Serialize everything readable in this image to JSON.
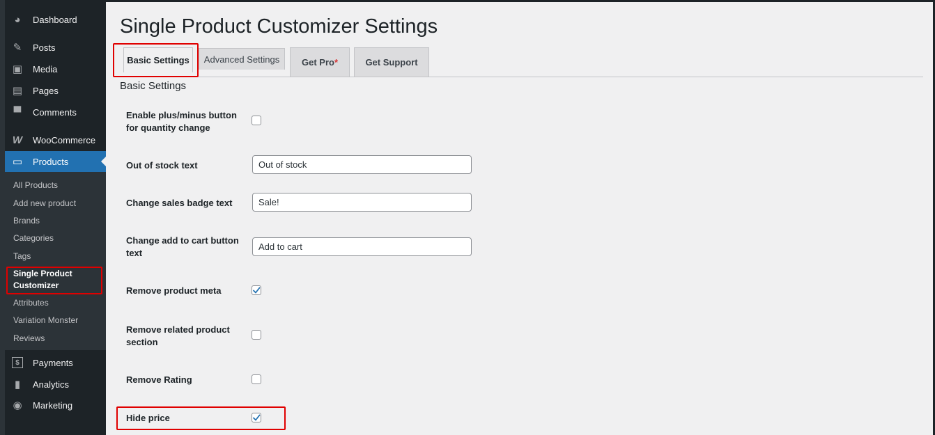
{
  "sidebar": {
    "items": [
      {
        "label": "Dashboard",
        "icon": "dashboard-icon"
      },
      {
        "label": "Posts",
        "icon": "pin-icon"
      },
      {
        "label": "Media",
        "icon": "media-icon"
      },
      {
        "label": "Pages",
        "icon": "pages-icon"
      },
      {
        "label": "Comments",
        "icon": "comments-icon"
      },
      {
        "label": "WooCommerce",
        "icon": "woocommerce-icon"
      },
      {
        "label": "Products",
        "icon": "products-icon"
      },
      {
        "label": "Payments",
        "icon": "payments-icon"
      },
      {
        "label": "Analytics",
        "icon": "analytics-icon"
      },
      {
        "label": "Marketing",
        "icon": "marketing-icon"
      }
    ],
    "submenu": [
      "All Products",
      "Add new product",
      "Brands",
      "Categories",
      "Tags",
      "Single Product Customizer",
      "Attributes",
      "Variation Monster",
      "Reviews"
    ]
  },
  "page": {
    "title": "Single Product Customizer Settings",
    "tabs": [
      "Basic Settings",
      "Advanced Settings",
      "Get Pro",
      "Get Support"
    ],
    "tab_star": "*",
    "section_title": "Basic Settings"
  },
  "fields": {
    "plus_minus": {
      "label": "Enable plus/minus button for quantity change",
      "checked": false
    },
    "out_of_stock": {
      "label": "Out of stock text",
      "value": "Out of stock"
    },
    "sales_badge": {
      "label": "Change sales badge text",
      "value": "Sale!"
    },
    "add_to_cart": {
      "label": "Change add to cart button text",
      "value": "Add to cart"
    },
    "remove_meta": {
      "label": "Remove product meta",
      "checked": true
    },
    "remove_related": {
      "label": "Remove related product section",
      "checked": false
    },
    "remove_rating": {
      "label": "Remove Rating",
      "checked": false
    },
    "hide_price": {
      "label": "Hide price",
      "checked": true
    }
  },
  "colors": {
    "accent": "#2271b1",
    "highlight": "#e00000",
    "sidebar_bg": "#1d2327"
  }
}
